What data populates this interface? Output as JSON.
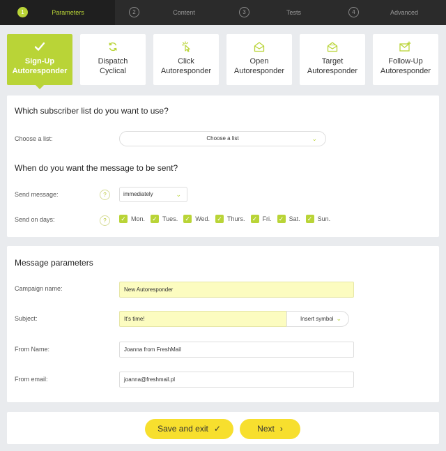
{
  "steps": [
    {
      "num": "1",
      "label": "Parameters"
    },
    {
      "num": "2",
      "label": "Content"
    },
    {
      "num": "3",
      "label": "Tests"
    },
    {
      "num": "4",
      "label": "Advanced"
    }
  ],
  "types": [
    {
      "icon": "check-icon",
      "line1": "Sign-Up",
      "line2": "Autoresponder"
    },
    {
      "icon": "refresh-icon",
      "line1": "Dispatch",
      "line2": "Cyclical"
    },
    {
      "icon": "cursor-click-icon",
      "line1": "Click",
      "line2": "Autoresponder"
    },
    {
      "icon": "envelope-open-icon",
      "line1": "Open",
      "line2": "Autoresponder"
    },
    {
      "icon": "envelope-target-icon",
      "line1": "Target",
      "line2": "Autoresponder"
    },
    {
      "icon": "envelope-followup-icon",
      "line1": "Follow-Up",
      "line2": "Autoresponder"
    }
  ],
  "list_section": {
    "heading": "Which subscriber list do you want to use?",
    "choose_label": "Choose a list:",
    "choose_value": "Choose a list"
  },
  "timing_section": {
    "heading": "When do you want the message to be sent?",
    "send_label": "Send message:",
    "send_value": "immediately",
    "days_label": "Send on days:",
    "help": "?",
    "days": [
      "Mon.",
      "Tues.",
      "Wed.",
      "Thurs.",
      "Fri.",
      "Sat.",
      "Sun."
    ]
  },
  "params": {
    "heading": "Message parameters",
    "campaign_label": "Campaign name:",
    "campaign_value": "New Autoresponder",
    "subject_label": "Subject:",
    "subject_value": "It's time!",
    "insert_symbol": "Insert symbol",
    "from_name_label": "From Name:",
    "from_name_value": "Joanna from FreshMail",
    "from_email_label": "From email:",
    "from_email_value": "joanna@freshmail.pl"
  },
  "actions": {
    "save": "Save and exit",
    "next": "Next"
  },
  "colors": {
    "accent": "#b9d437",
    "button": "#f7df2e",
    "dark": "#2b2b2b",
    "field_highlight": "#fcfcc0"
  }
}
